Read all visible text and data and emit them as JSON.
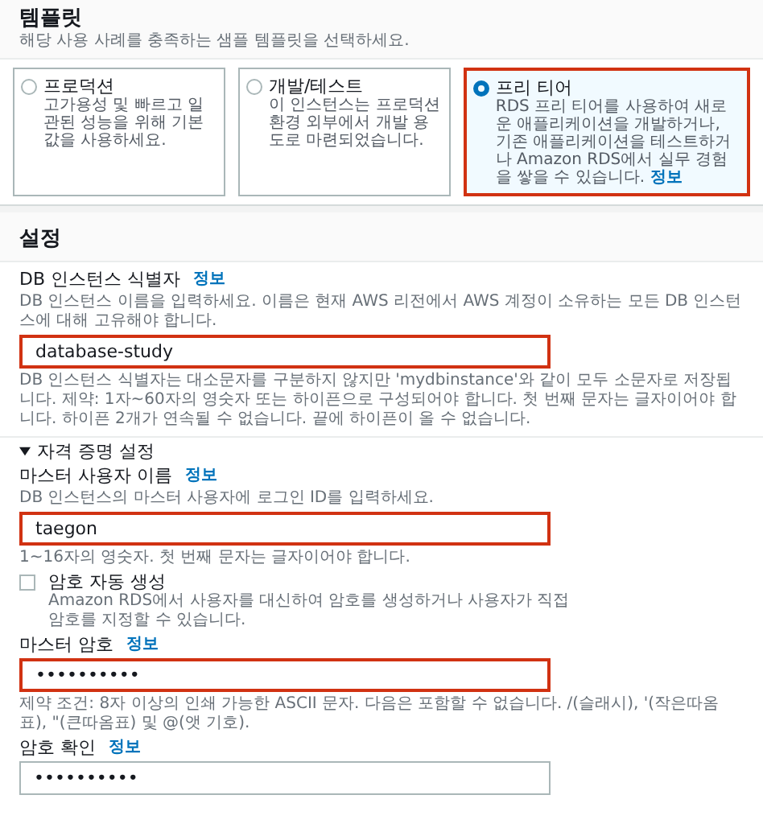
{
  "template": {
    "title": "템플릿",
    "subtitle": "해당 사용 사례를 충족하는 샘플 템플릿을 선택하세요.",
    "options": [
      {
        "label": "프로덕션",
        "description": "고가용성 및 빠르고 일관된 성능을 위해 기본값을 사용하세요.",
        "selected": false,
        "highlighted": false
      },
      {
        "label": "개발/테스트",
        "description": "이 인스턴스는 프로덕션 환경 외부에서 개발 용도로 마련되었습니다.",
        "selected": false,
        "highlighted": false
      },
      {
        "label": "프리 티어",
        "description": "RDS 프리 티어를 사용하여 새로운 애플리케이션을 개발하거나, 기존 애플리케이션을 테스트하거나 Amazon RDS에서 실무 경험을 쌓을 수 있습니다.",
        "info": "정보",
        "selected": true,
        "highlighted": true
      }
    ]
  },
  "settings": {
    "title": "설정",
    "identifier": {
      "label": "DB 인스턴스 식별자",
      "info": "정보",
      "hint": "DB 인스턴스 이름을 입력하세요. 이름은 현재 AWS 리전에서 AWS 계정이 소유하는 모든 DB 인스턴스에 대해 고유해야 합니다.",
      "value": "database-study",
      "highlighted": true,
      "constraint": "DB 인스턴스 식별자는 대소문자를 구분하지 않지만 'mydbinstance'와 같이 모두 소문자로 저장됩니다. 제약: 1자~60자의 영숫자 또는 하이픈으로 구성되어야 합니다. 첫 번째 문자는 글자이어야 합니다. 하이픈 2개가 연속될 수 없습니다. 끝에 하이픈이 올 수 없습니다."
    },
    "credentials": {
      "title": "자격 증명 설정",
      "expanded": true,
      "username": {
        "label": "마스터 사용자 이름",
        "info": "정보",
        "hint": "DB 인스턴스의 마스터 사용자에 로그인 ID를 입력하세요.",
        "value": "taegon",
        "highlighted": true,
        "constraint": "1~16자의 영숫자. 첫 번째 문자는 글자이어야 합니다."
      },
      "auto_password": {
        "label": "암호 자동 생성",
        "description": "Amazon RDS에서 사용자를 대신하여 암호를 생성하거나 사용자가 직접 암호를 지정할 수 있습니다.",
        "checked": false
      },
      "password": {
        "label": "마스터 암호",
        "info": "정보",
        "value": "••••••••••",
        "highlighted": true,
        "constraint": "제약 조건: 8자 이상의 인쇄 가능한 ASCII 문자. 다음은 포함할 수 없습니다. /(슬래시), '(작은따옴표), \"(큰따옴표) 및 @(앳 기호)."
      },
      "confirm": {
        "label": "암호 확인",
        "info": "정보",
        "value": "••••••••••",
        "highlighted": false
      }
    }
  }
}
